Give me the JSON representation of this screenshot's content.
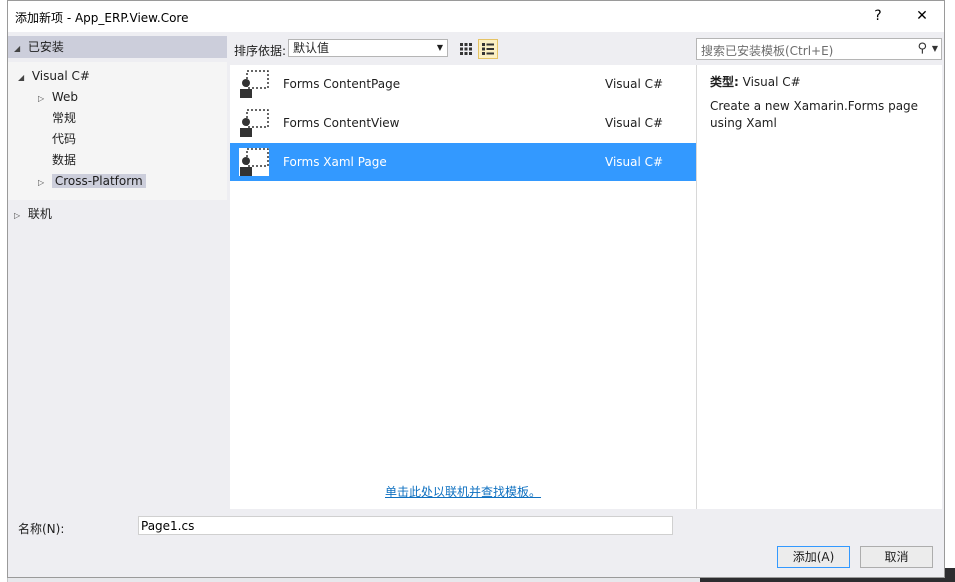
{
  "window": {
    "title": "添加新项 - App_ERP.View.Core",
    "help_label": "?",
    "close_label": "✕"
  },
  "tree": {
    "installed": "已安装",
    "visual_csharp": "Visual C#",
    "items": [
      "Web",
      "常规",
      "代码",
      "数据",
      "Cross-Platform"
    ],
    "online": "联机"
  },
  "toolbar": {
    "sort_label": "排序依据:",
    "sort_value": "默认值"
  },
  "templates": [
    {
      "name": "Forms ContentPage",
      "language": "Visual C#",
      "icon": "forms-page-icon"
    },
    {
      "name": "Forms ContentView",
      "language": "Visual C#",
      "icon": "forms-view-icon"
    },
    {
      "name": "Forms Xaml Page",
      "language": "Visual C#",
      "icon": "forms-xaml-icon"
    }
  ],
  "selected_index": 2,
  "online_link": "单击此处以联机并查找模板。",
  "search": {
    "placeholder": "搜索已安装模板(Ctrl+E)"
  },
  "details": {
    "type_label": "类型:",
    "type_value": "Visual C#",
    "description": "Create a new Xamarin.Forms page using Xaml"
  },
  "footer": {
    "name_label": "名称(N):",
    "name_value": "Page1.cs",
    "add_label": "添加(A)",
    "cancel_label": "取消"
  },
  "colors": {
    "selection": "#3399ff",
    "link": "#0e70c0",
    "tree_highlight": "#cccedb"
  }
}
